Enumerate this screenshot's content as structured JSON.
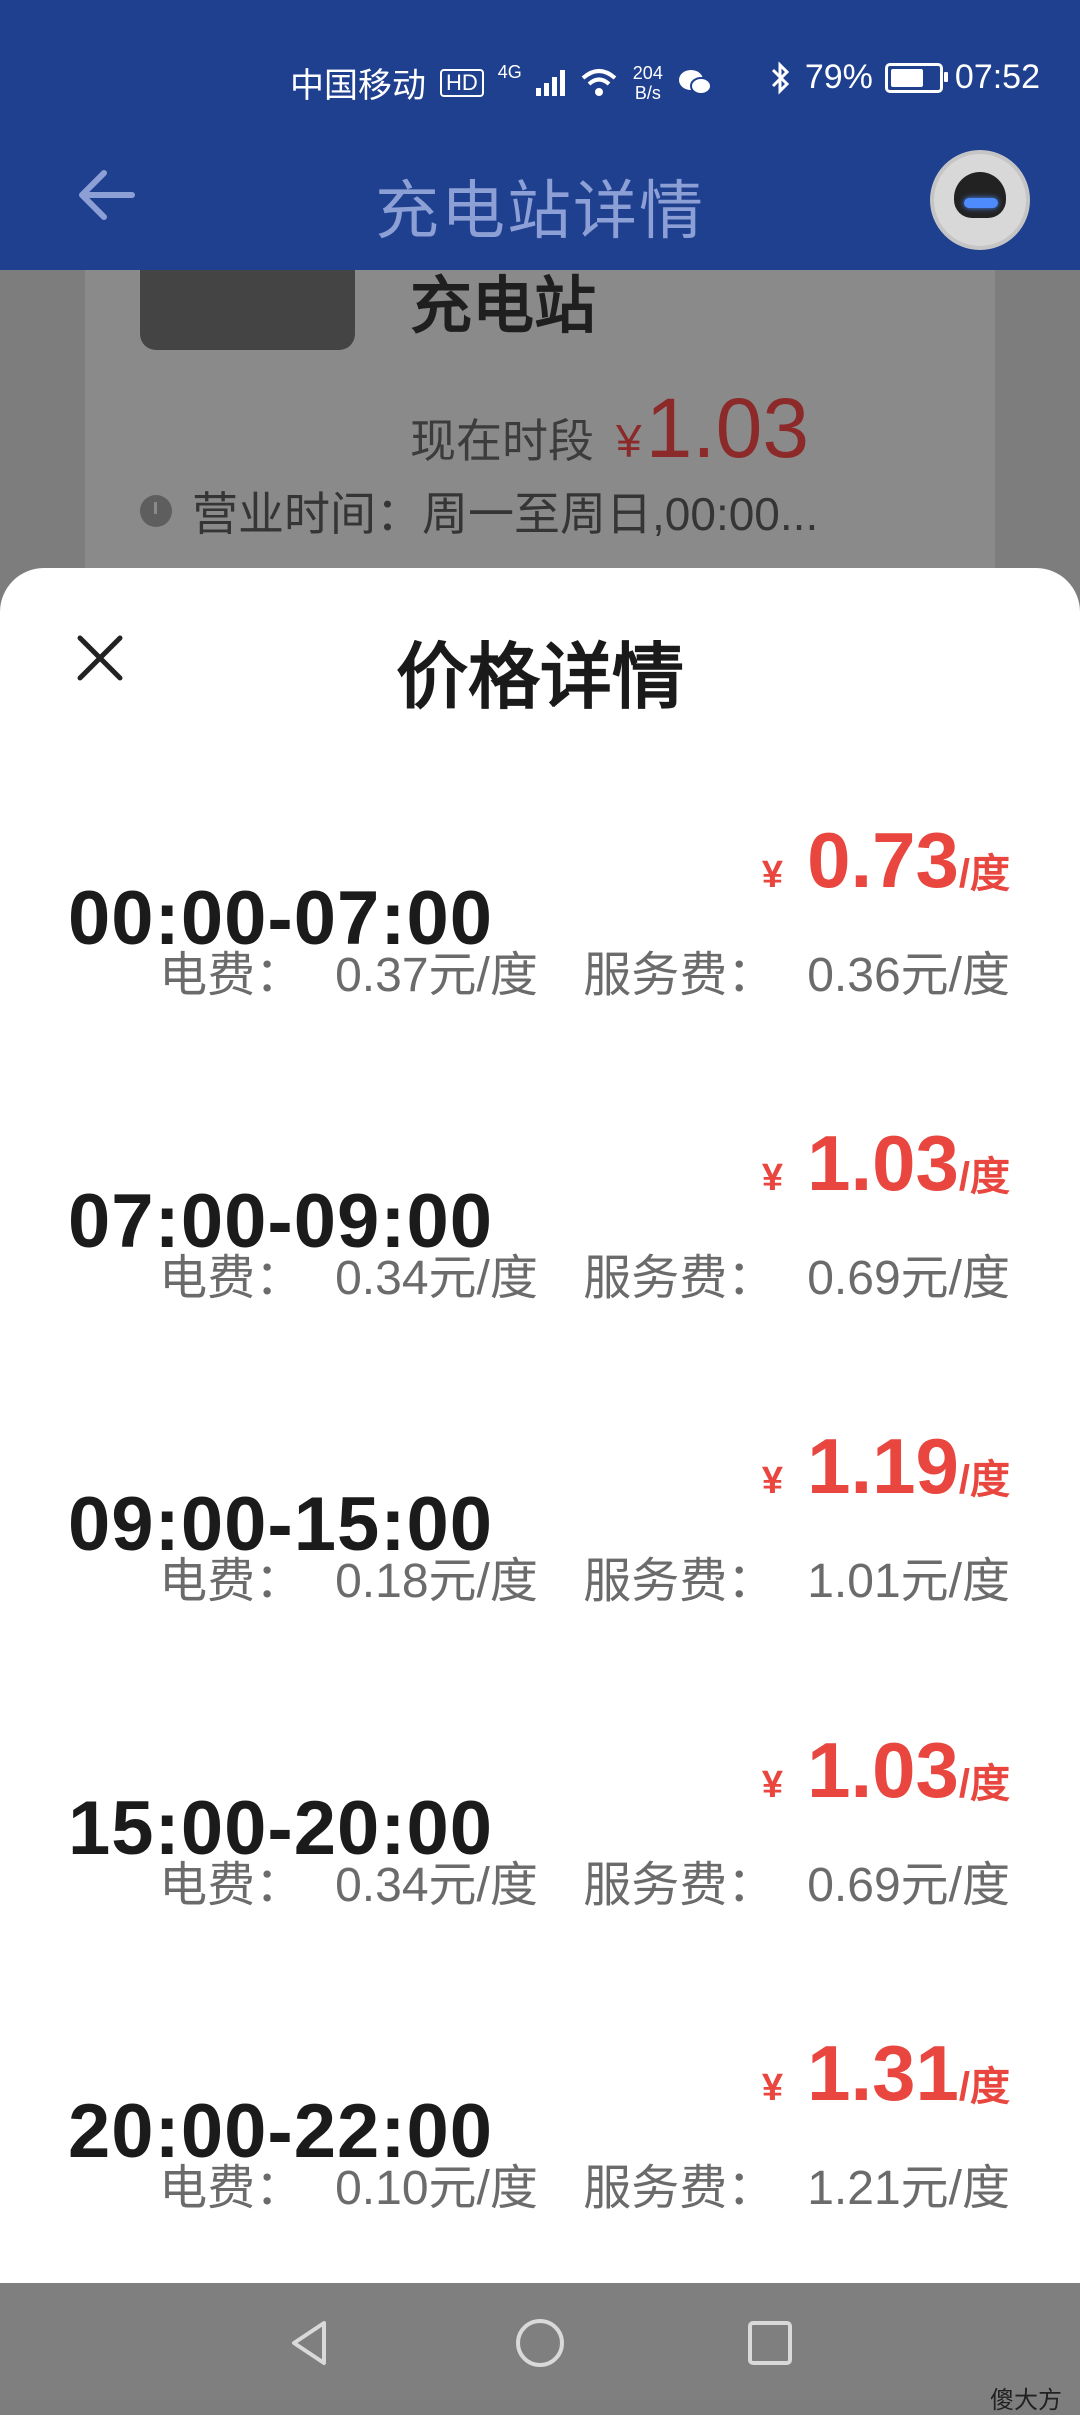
{
  "status": {
    "carrier": "中国移动",
    "hd": "HD",
    "net": "4G",
    "speed_value": "204",
    "speed_unit": "B/s",
    "bluetooth_icon": "bluetooth-icon",
    "battery_percent": "79%",
    "battery_level": 0.79,
    "time": "07:52"
  },
  "header": {
    "title": "充电站详情"
  },
  "background": {
    "station_name": "充电站",
    "now_label": "现在时段",
    "now_currency": "¥",
    "now_price": "1.03",
    "hours_text": "营业时间：周一至周日,00:00..."
  },
  "sheet": {
    "title": "价格详情",
    "rows": [
      {
        "time": "00:00-07:00",
        "currency": "¥",
        "price": "0.73",
        "unit": "/度",
        "elec_label": "电费：",
        "elec_value": "0.37元/度",
        "service_label": "服务费：",
        "service_value": "0.36元/度"
      },
      {
        "time": "07:00-09:00",
        "currency": "¥",
        "price": "1.03",
        "unit": "/度",
        "elec_label": "电费：",
        "elec_value": "0.34元/度",
        "service_label": "服务费：",
        "service_value": "0.69元/度"
      },
      {
        "time": "09:00-15:00",
        "currency": "¥",
        "price": "1.19",
        "unit": "/度",
        "elec_label": "电费：",
        "elec_value": "0.18元/度",
        "service_label": "服务费：",
        "service_value": "1.01元/度"
      },
      {
        "time": "15:00-20:00",
        "currency": "¥",
        "price": "1.03",
        "unit": "/度",
        "elec_label": "电费：",
        "elec_value": "0.34元/度",
        "service_label": "服务费：",
        "service_value": "0.69元/度"
      },
      {
        "time": "20:00-22:00",
        "currency": "¥",
        "price": "1.31",
        "unit": "/度",
        "elec_label": "电费：",
        "elec_value": "0.10元/度",
        "service_label": "服务费：",
        "service_value": "1.21元/度"
      }
    ]
  },
  "watermark": "傻大方",
  "colors": {
    "header_bg": "#1f3f8f",
    "price_red": "#e8463f",
    "sheet_bg": "#ffffff"
  }
}
